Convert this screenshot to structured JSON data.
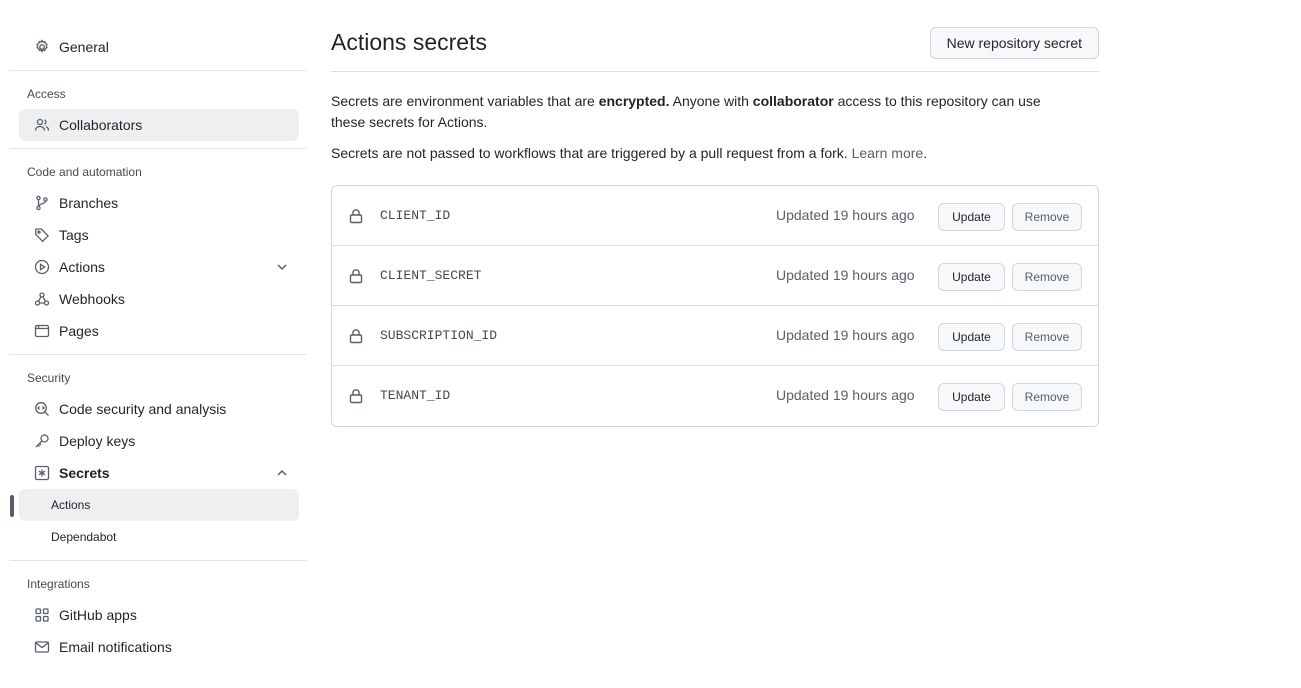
{
  "sidebar": {
    "general": "General",
    "groups": {
      "access": "Access",
      "code_automation": "Code and automation",
      "security": "Security",
      "integrations": "Integrations"
    },
    "items": {
      "collaborators": "Collaborators",
      "branches": "Branches",
      "tags": "Tags",
      "actions": "Actions",
      "webhooks": "Webhooks",
      "pages": "Pages",
      "code_security": "Code security and analysis",
      "deploy_keys": "Deploy keys",
      "secrets": "Secrets",
      "secrets_actions": "Actions",
      "secrets_dependabot": "Dependabot",
      "github_apps": "GitHub apps",
      "email_notifications": "Email notifications"
    }
  },
  "main": {
    "title": "Actions secrets",
    "new_button": "New repository secret",
    "desc1_a": "Secrets are environment variables that are ",
    "desc1_b": "encrypted.",
    "desc1_c": " Anyone with ",
    "desc1_d": "collaborator",
    "desc1_e": " access to this repository can use these secrets for Actions.",
    "desc2_a": "Secrets are not passed to workflows that are triggered by a pull request from a fork. ",
    "desc2_link": "Learn more",
    "desc2_end": ".",
    "update_label": "Update",
    "remove_label": "Remove",
    "secrets": [
      {
        "name": "CLIENT_ID",
        "updated": "Updated 19 hours ago"
      },
      {
        "name": "CLIENT_SECRET",
        "updated": "Updated 19 hours ago"
      },
      {
        "name": "SUBSCRIPTION_ID",
        "updated": "Updated 19 hours ago"
      },
      {
        "name": "TENANT_ID",
        "updated": "Updated 19 hours ago"
      }
    ]
  },
  "colors": {
    "text": "#1f2328",
    "muted": "#57606a",
    "border": "#d0d7de",
    "active_bg": "#eeeff1"
  }
}
